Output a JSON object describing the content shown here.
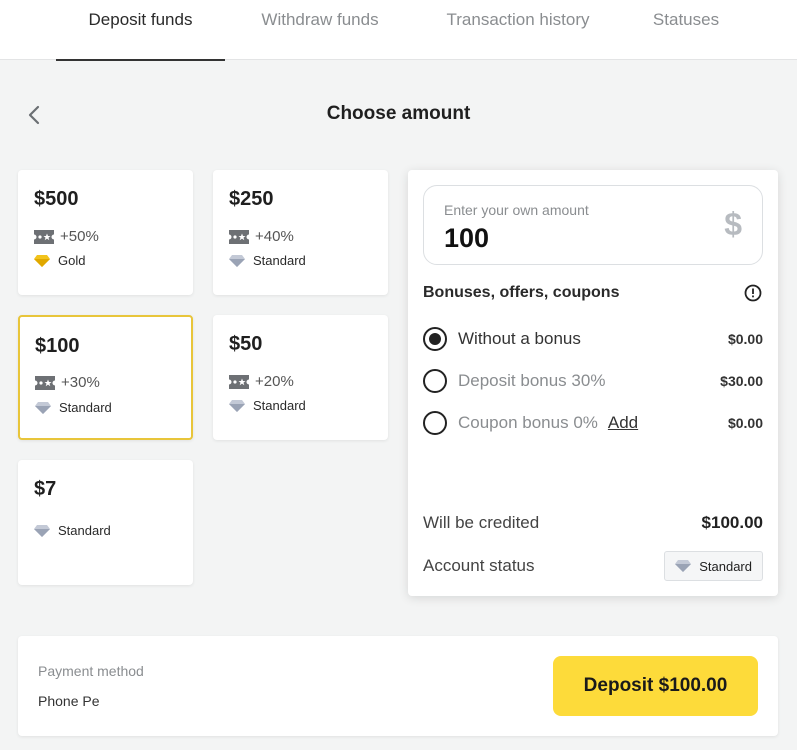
{
  "tabs": [
    {
      "label": "Deposit funds",
      "active": true
    },
    {
      "label": "Withdraw funds",
      "active": false
    },
    {
      "label": "Transaction history",
      "active": false
    },
    {
      "label": "Statuses",
      "active": false
    }
  ],
  "header": {
    "title": "Choose amount"
  },
  "amount_cards": [
    {
      "amount": "$500",
      "bonus": "+50%",
      "status": "Gold",
      "selected": false
    },
    {
      "amount": "$250",
      "bonus": "+40%",
      "status": "Standard",
      "selected": false
    },
    {
      "amount": "$100",
      "bonus": "+30%",
      "status": "Standard",
      "selected": true
    },
    {
      "amount": "$50",
      "bonus": "+20%",
      "status": "Standard",
      "selected": false
    },
    {
      "amount": "$7",
      "bonus": "",
      "status": "Standard",
      "selected": false
    }
  ],
  "custom_amount": {
    "label": "Enter your own amount",
    "value": "100",
    "currency_symbol": "$"
  },
  "bonuses": {
    "title": "Bonuses, offers, coupons",
    "options": [
      {
        "label": "Without a bonus",
        "value": "$0.00",
        "checked": true
      },
      {
        "label": "Deposit bonus 30%",
        "value": "$30.00",
        "checked": false
      },
      {
        "label": "Coupon bonus 0%",
        "value": "$0.00",
        "checked": false,
        "link": "Add"
      }
    ]
  },
  "summary": {
    "credited_label": "Will be credited",
    "credited_value": "$100.00",
    "status_label": "Account status",
    "status_value": "Standard"
  },
  "payment": {
    "method_label": "Payment method",
    "method_value": "Phone Pe",
    "deposit_button": "Deposit $100.00"
  },
  "colors": {
    "accent_yellow": "#fddb3a",
    "selected_border": "#e8c53a",
    "gold_gem": "#f2c31b",
    "standard_gem": "#9aa3b5"
  }
}
